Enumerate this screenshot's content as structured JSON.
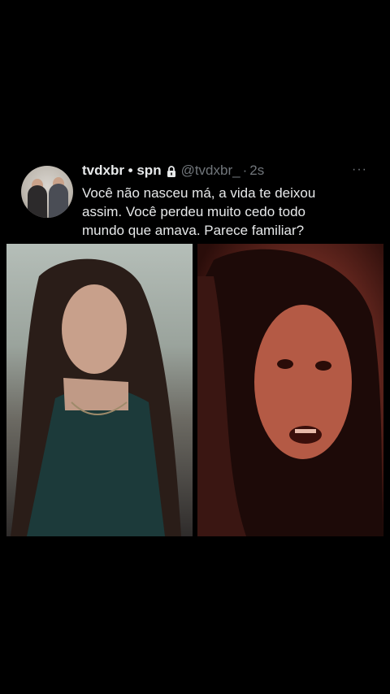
{
  "tweet": {
    "display_name": "tvdxbr • spn",
    "handle": "@tvdxbr_",
    "separator": "·",
    "time": "2s",
    "more": "···",
    "text": "Você não nasceu má, a vida te deixou assim. Você perdeu muito cedo todo mundo que amava. Parece familiar?"
  },
  "icons": {
    "lock": "lock-icon",
    "more": "more-icon"
  },
  "colors": {
    "background": "#000000",
    "text": "#e7e9ea",
    "muted": "#71767b"
  }
}
